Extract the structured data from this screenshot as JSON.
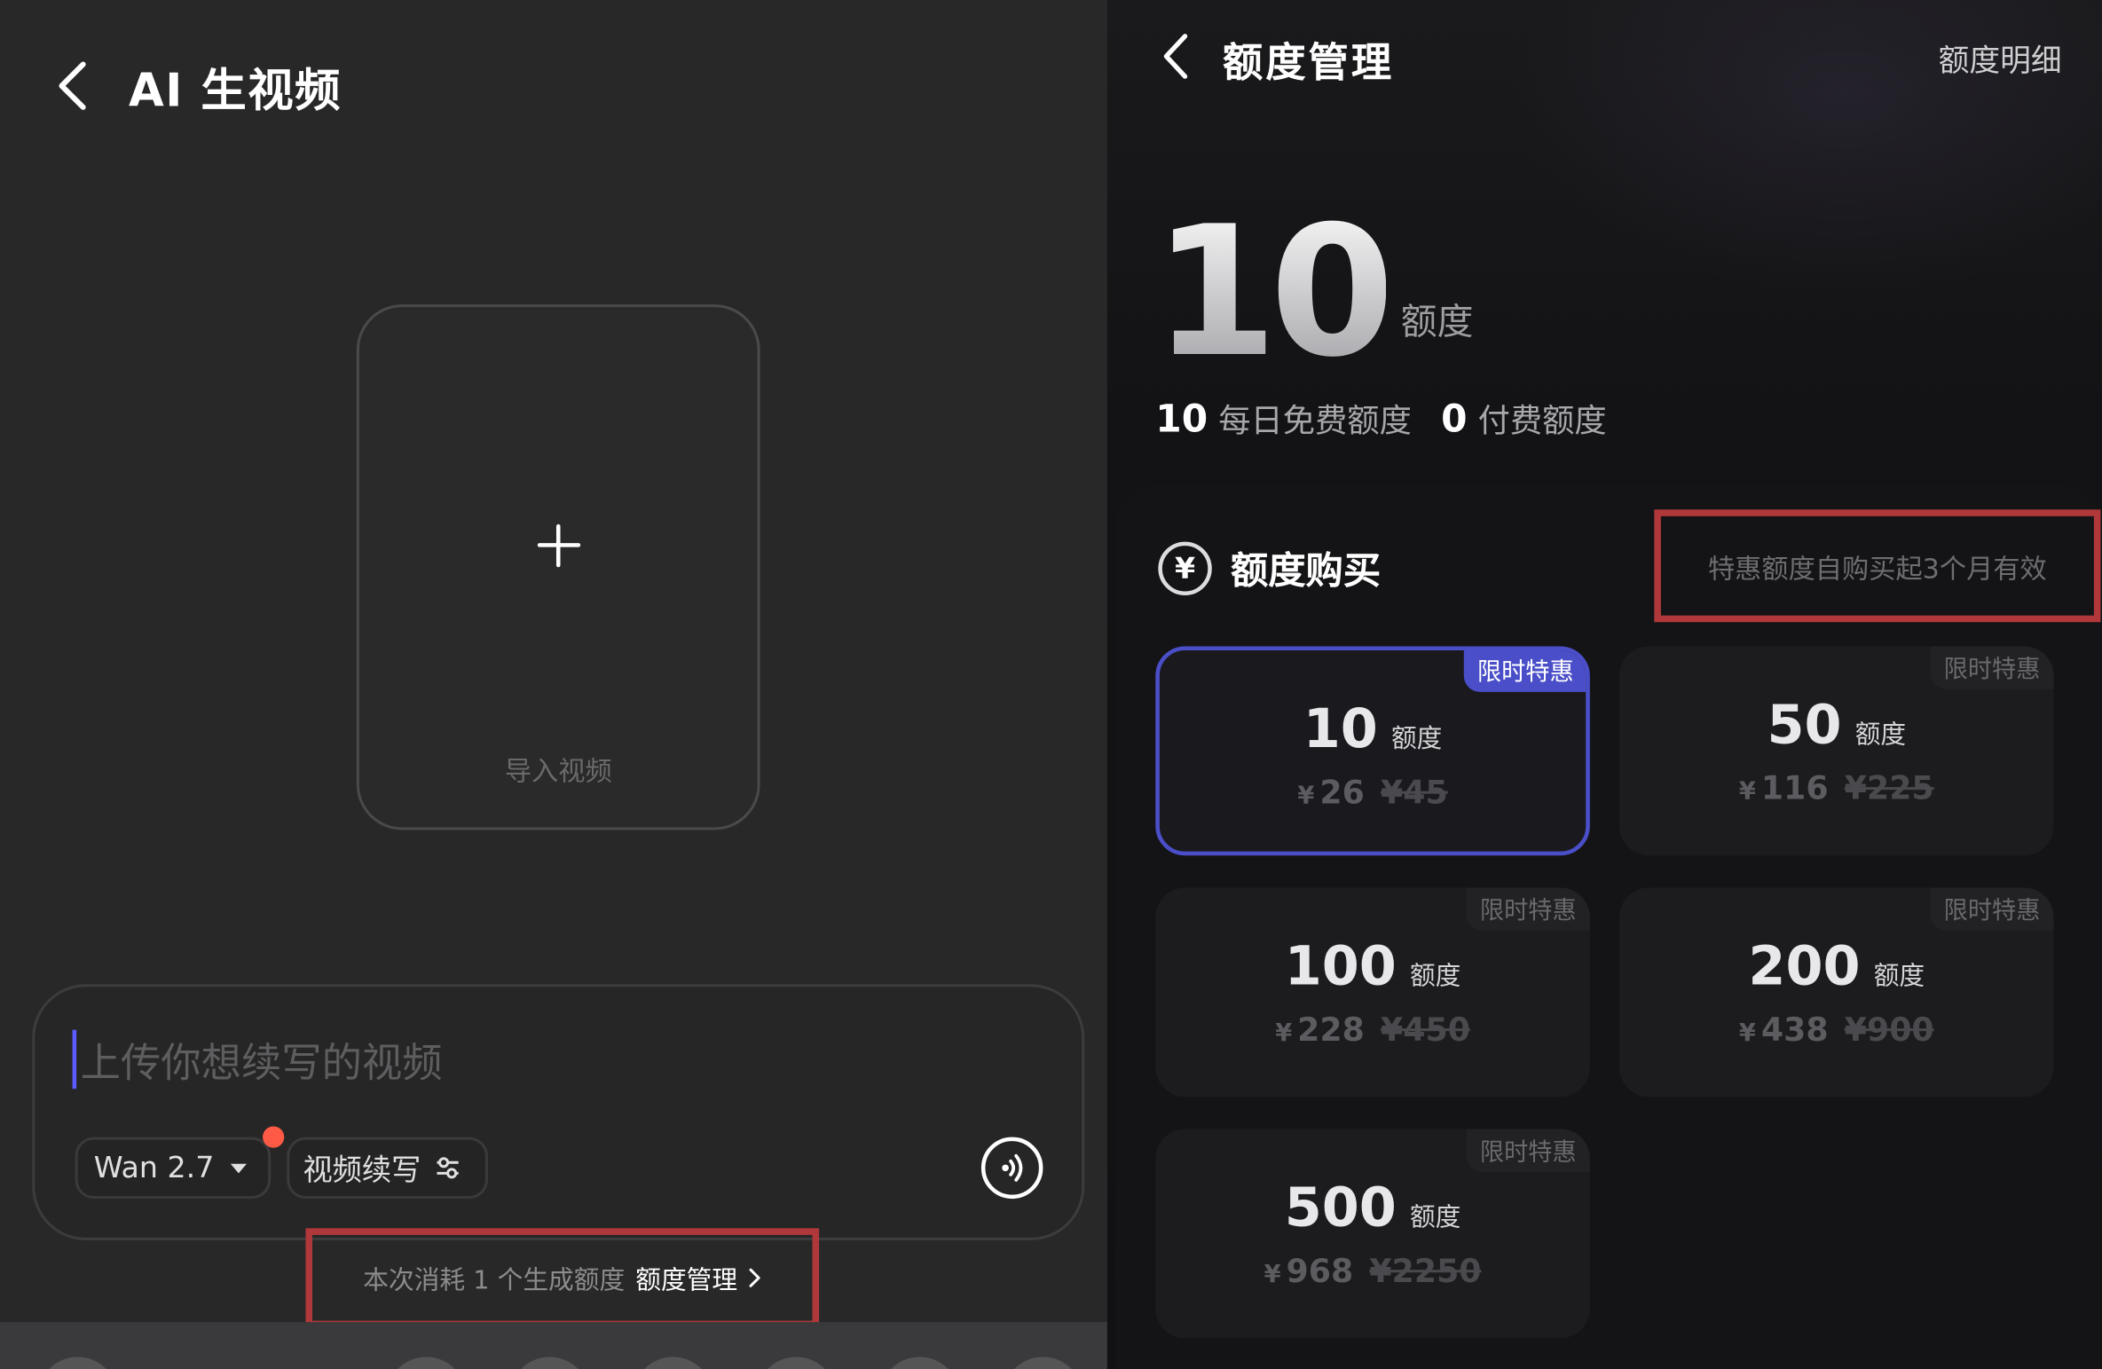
{
  "left": {
    "title": "AI 生视频",
    "upload_label": "导入视频",
    "prompt_placeholder": "上传你想续写的视频",
    "model_label": "Wan 2.7",
    "mode_label": "视频续写",
    "quota_text": "本次消耗 1 个生成额度",
    "quota_link": "额度管理"
  },
  "right": {
    "title": "额度管理",
    "detail_link": "额度明细",
    "total": "10",
    "total_unit": "额度",
    "free_value": "10",
    "free_label": "每日免费额度",
    "paid_value": "0",
    "paid_label": "付费额度",
    "buy_title": "额度购买",
    "yen_symbol": "¥",
    "promo_note": "特惠额度自购买起3个月有效",
    "packages": [
      {
        "amount": "10",
        "unit": "额度",
        "price": "26",
        "original": "¥45",
        "tag": "限时特惠",
        "selected": true
      },
      {
        "amount": "50",
        "unit": "额度",
        "price": "116",
        "original": "¥225",
        "tag": "限时特惠",
        "selected": false
      },
      {
        "amount": "100",
        "unit": "额度",
        "price": "228",
        "original": "¥450",
        "tag": "限时特惠",
        "selected": false
      },
      {
        "amount": "200",
        "unit": "额度",
        "price": "438",
        "original": "¥900",
        "tag": "限时特惠",
        "selected": false
      },
      {
        "amount": "500",
        "unit": "额度",
        "price": "968",
        "original": "¥2250",
        "tag": "限时特惠",
        "selected": false
      }
    ]
  },
  "colors": {
    "accent": "#4a4fc9",
    "highlight_box": "#b0383a",
    "notification_dot": "#ff5a45",
    "caret": "#5b5bff"
  }
}
